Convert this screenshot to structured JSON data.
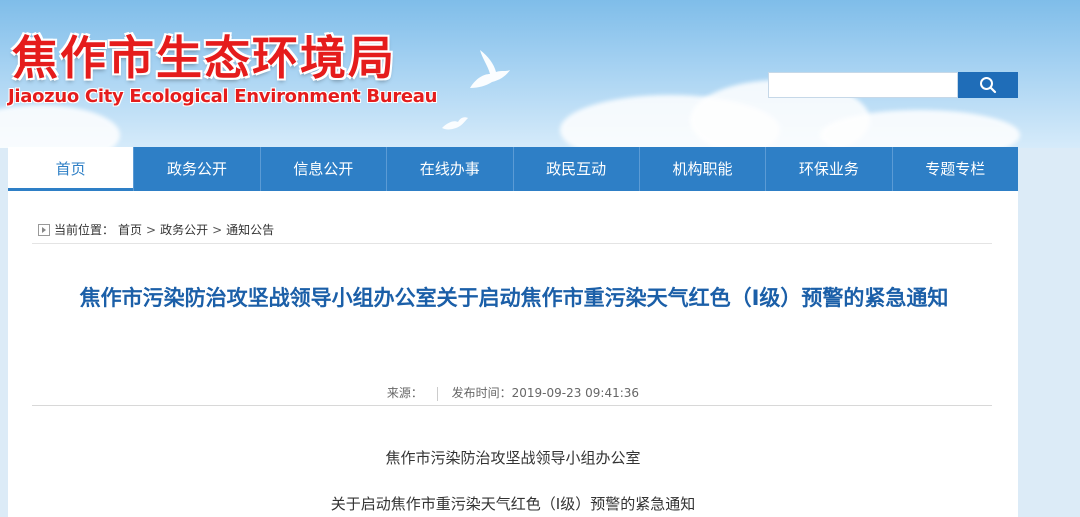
{
  "header": {
    "logo_cn": "焦作市生态环境局",
    "logo_en": "Jiaozuo City Ecological Environment Bureau",
    "search": {
      "placeholder": ""
    }
  },
  "nav": {
    "items": [
      {
        "label": "首页",
        "active": true
      },
      {
        "label": "政务公开"
      },
      {
        "label": "信息公开"
      },
      {
        "label": "在线办事"
      },
      {
        "label": "政民互动"
      },
      {
        "label": "机构职能"
      },
      {
        "label": "环保业务"
      },
      {
        "label": "专题专栏"
      }
    ]
  },
  "breadcrumb": {
    "prefix": "当前位置：",
    "items": [
      "首页",
      "政务公开",
      "通知公告"
    ],
    "separator": ">"
  },
  "article": {
    "title": "焦作市污染防治攻坚战领导小组办公室关于启动焦作市重污染天气红色（Ⅰ级）预警的紧急通知",
    "source_label": "来源：",
    "publish_label": "发布时间：",
    "publish_time": "2019-09-23 09:41:36",
    "body_lines": [
      "焦作市污染防治攻坚战领导小组办公室",
      "关于启动焦作市重污染天气红色（Ⅰ级）预警的紧急通知"
    ]
  },
  "colors": {
    "nav_bg": "#2e7fc6",
    "title": "#1b5fa8",
    "logo": "#e51c1c",
    "search_btn": "#1f6db8"
  }
}
